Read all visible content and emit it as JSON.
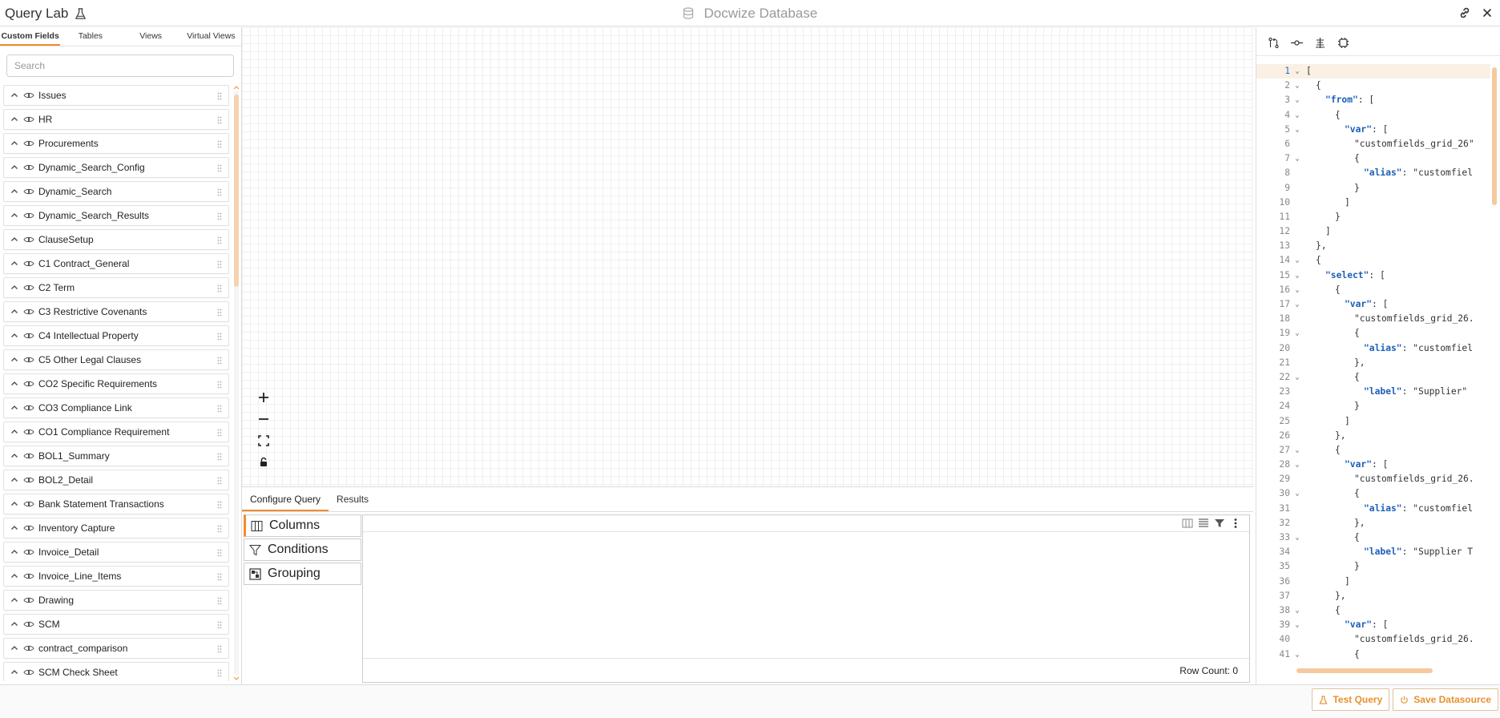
{
  "titlebar": {
    "app_title": "Query Lab",
    "db_title": "Docwize Database"
  },
  "left": {
    "tabs": [
      "Custom Fields",
      "Tables",
      "Views",
      "Virtual Views"
    ],
    "active_tab": 0,
    "search_placeholder": "Search",
    "items": [
      "Issues",
      "HR",
      "Procurements",
      "Dynamic_Search_Config",
      "Dynamic_Search",
      "Dynamic_Search_Results",
      "ClauseSetup",
      "C1 Contract_General",
      "C2 Term",
      "C3 Restrictive Covenants",
      "C4 Intellectual Property",
      "C5 Other Legal Clauses",
      "CO2 Specific Requirements",
      "CO3 Compliance Link",
      "CO1 Compliance Requirement",
      "BOL1_Summary",
      "BOL2_Detail",
      "Bank Statement Transactions",
      "Inventory Capture",
      "Invoice_Detail",
      "Invoice_Line_Items",
      "Drawing",
      "SCM",
      "contract_comparison",
      "SCM Check Sheet"
    ]
  },
  "bottom": {
    "tabs": [
      "Configure Query",
      "Results"
    ],
    "config_items": [
      "Columns",
      "Conditions",
      "Grouping"
    ],
    "row_count": "Row Count: 0"
  },
  "code": {
    "lines": [
      {
        "n": "1",
        "fold": true,
        "ind": 0,
        "t": "["
      },
      {
        "n": "2",
        "fold": true,
        "ind": 1,
        "t": "{"
      },
      {
        "n": "3",
        "fold": true,
        "ind": 2,
        "k": "\"from\"",
        "t": ": ["
      },
      {
        "n": "4",
        "fold": true,
        "ind": 3,
        "t": "{"
      },
      {
        "n": "5",
        "fold": true,
        "ind": 4,
        "k": "\"var\"",
        "t": ": ["
      },
      {
        "n": "6",
        "fold": false,
        "ind": 5,
        "t": "\"customfields_grid_26\""
      },
      {
        "n": "7",
        "fold": true,
        "ind": 5,
        "t": "{"
      },
      {
        "n": "8",
        "fold": false,
        "ind": 6,
        "k": "\"alias\"",
        "t": ": \"customfiel"
      },
      {
        "n": "9",
        "fold": false,
        "ind": 5,
        "t": "}"
      },
      {
        "n": "10",
        "fold": false,
        "ind": 4,
        "t": "]"
      },
      {
        "n": "11",
        "fold": false,
        "ind": 3,
        "t": "}"
      },
      {
        "n": "12",
        "fold": false,
        "ind": 2,
        "t": "]"
      },
      {
        "n": "13",
        "fold": false,
        "ind": 1,
        "t": "},"
      },
      {
        "n": "14",
        "fold": true,
        "ind": 1,
        "t": "{"
      },
      {
        "n": "15",
        "fold": true,
        "ind": 2,
        "k": "\"select\"",
        "t": ": ["
      },
      {
        "n": "16",
        "fold": true,
        "ind": 3,
        "t": "{"
      },
      {
        "n": "17",
        "fold": true,
        "ind": 4,
        "k": "\"var\"",
        "t": ": ["
      },
      {
        "n": "18",
        "fold": false,
        "ind": 5,
        "t": "\"customfields_grid_26."
      },
      {
        "n": "19",
        "fold": true,
        "ind": 5,
        "t": "{"
      },
      {
        "n": "20",
        "fold": false,
        "ind": 6,
        "k": "\"alias\"",
        "t": ": \"customfiel"
      },
      {
        "n": "21",
        "fold": false,
        "ind": 5,
        "t": "},"
      },
      {
        "n": "22",
        "fold": true,
        "ind": 5,
        "t": "{"
      },
      {
        "n": "23",
        "fold": false,
        "ind": 6,
        "k": "\"label\"",
        "t": ": \"Supplier\""
      },
      {
        "n": "24",
        "fold": false,
        "ind": 5,
        "t": "}"
      },
      {
        "n": "25",
        "fold": false,
        "ind": 4,
        "t": "]"
      },
      {
        "n": "26",
        "fold": false,
        "ind": 3,
        "t": "},"
      },
      {
        "n": "27",
        "fold": true,
        "ind": 3,
        "t": "{"
      },
      {
        "n": "28",
        "fold": true,
        "ind": 4,
        "k": "\"var\"",
        "t": ": ["
      },
      {
        "n": "29",
        "fold": false,
        "ind": 5,
        "t": "\"customfields_grid_26."
      },
      {
        "n": "30",
        "fold": true,
        "ind": 5,
        "t": "{"
      },
      {
        "n": "31",
        "fold": false,
        "ind": 6,
        "k": "\"alias\"",
        "t": ": \"customfiel"
      },
      {
        "n": "32",
        "fold": false,
        "ind": 5,
        "t": "},"
      },
      {
        "n": "33",
        "fold": true,
        "ind": 5,
        "t": "{"
      },
      {
        "n": "34",
        "fold": false,
        "ind": 6,
        "k": "\"label\"",
        "t": ": \"Supplier T"
      },
      {
        "n": "35",
        "fold": false,
        "ind": 5,
        "t": "}"
      },
      {
        "n": "36",
        "fold": false,
        "ind": 4,
        "t": "]"
      },
      {
        "n": "37",
        "fold": false,
        "ind": 3,
        "t": "},"
      },
      {
        "n": "38",
        "fold": true,
        "ind": 3,
        "t": "{"
      },
      {
        "n": "39",
        "fold": true,
        "ind": 4,
        "k": "\"var\"",
        "t": ": ["
      },
      {
        "n": "40",
        "fold": false,
        "ind": 5,
        "t": "\"customfields_grid_26."
      },
      {
        "n": "41",
        "fold": true,
        "ind": 5,
        "t": "{"
      }
    ]
  },
  "footer": {
    "test_query": "Test Query",
    "save_datasource": "Save Datasource"
  },
  "colors": {
    "accent": "#f28c28",
    "json_key": "#1d5fb7"
  }
}
